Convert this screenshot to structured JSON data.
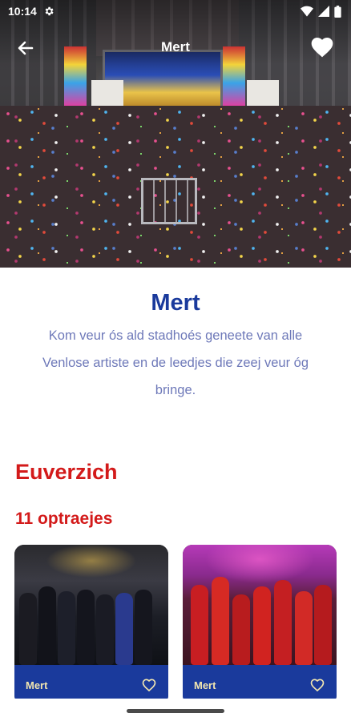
{
  "status_bar": {
    "time": "10:14",
    "icons": [
      "settings-gear-icon",
      "wifi-icon",
      "signal-icon",
      "battery-icon"
    ]
  },
  "app_bar": {
    "title": "Mert",
    "back_icon": "arrow-left-icon",
    "favorite_icon": "heart-filled-icon"
  },
  "main": {
    "title": "Mert",
    "description": "Kom veur ós ald stadhoés geneete van alle Venlose artiste en de leedjes die zeej veur óg bringe.",
    "section_title": "Euverzich",
    "performances_count_label": "11 optraejes"
  },
  "cards": [
    {
      "name": "Mert",
      "heart_icon": "heart-outline-icon"
    },
    {
      "name": "Mert",
      "heart_icon": "heart-outline-icon"
    }
  ],
  "colors": {
    "primary_blue": "#1a3a9c",
    "accent_red": "#d31a1a",
    "description_text": "#6e79b9",
    "card_label": "#f2e6b0"
  }
}
